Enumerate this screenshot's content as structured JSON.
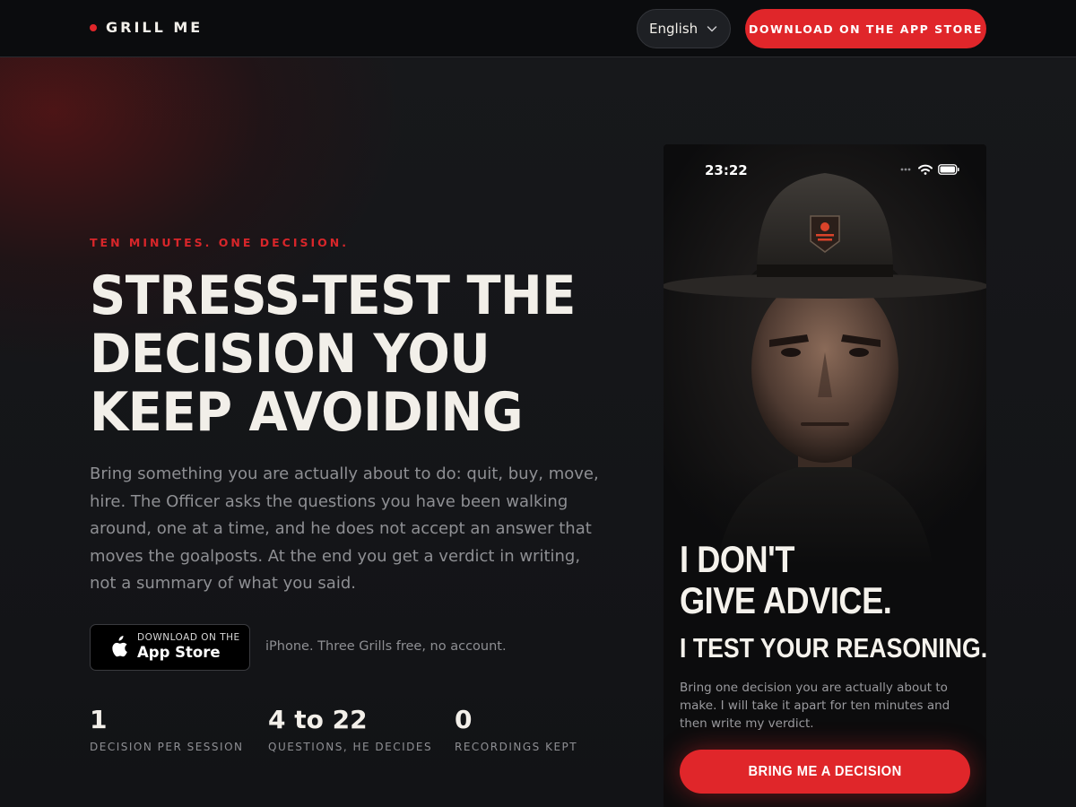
{
  "brand": {
    "name": "GRILL ME",
    "accent": "#e0262a"
  },
  "header": {
    "language": "English",
    "cta_label": "DOWNLOAD ON THE APP STORE"
  },
  "hero": {
    "eyebrow": "TEN MINUTES. ONE DECISION.",
    "headline_lines": [
      "STRESS-TEST THE",
      "DECISION YOU",
      "KEEP AVOIDING"
    ],
    "intro": "Bring something you are actually about to do: quit, buy, move, hire. The Officer asks the questions you have been walking around, one at a time, and he does not accept an answer that moves the goalposts. At the end you get a verdict in writing, not a summary of what you said.",
    "app_store": {
      "small": "Download on the",
      "big": "App Store",
      "icon": "apple-icon"
    },
    "app_note": "iPhone. Three Grills free, no account."
  },
  "stats": [
    {
      "value": "1",
      "label": "DECISION PER SESSION"
    },
    {
      "value": "4 to 22",
      "label": "QUESTIONS, HE DECIDES"
    },
    {
      "value": "0",
      "label": "RECORDINGS KEPT"
    }
  ],
  "phone": {
    "time": "23:22",
    "status_icons": [
      "signal-icon",
      "wifi-icon",
      "battery-icon"
    ],
    "title_lines": [
      "I DON'T",
      "GIVE ADVICE."
    ],
    "subtitle": "I TEST YOUR REASONING.",
    "body": "Bring one decision you are actually about to make. I will take it apart for ten minutes and then write my verdict.",
    "cta": "BRING ME A DECISION"
  }
}
